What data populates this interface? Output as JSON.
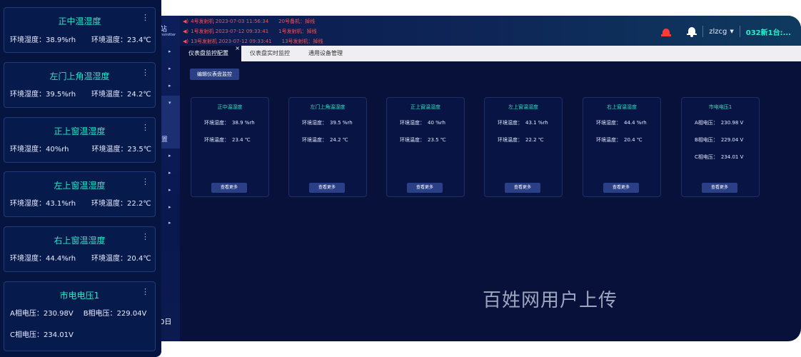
{
  "alarms": [
    {
      "text": "4号发射机 2023-07-03 11:56:34",
      "extra": "20号备机：掉线"
    },
    {
      "text": "1号发射机 2023-07-12 09:33:41",
      "extra": "1号发射机：掉线"
    },
    {
      "text": "13号发射机 2023-07-12 09:33:41",
      "extra": "13号发射机：掉线"
    }
  ],
  "header": {
    "site_fragment": "站",
    "site_sub": "ransmitter",
    "user": "zlzcg",
    "station": "032新1台:..."
  },
  "sidebar": {
    "active_fragment": "置",
    "date_fragment": "0日"
  },
  "tabs": [
    {
      "label": "仪表盘监控配置",
      "active": true
    },
    {
      "label": "仪表盘实时监控",
      "active": false
    },
    {
      "label": "通用设备管理",
      "active": false
    }
  ],
  "edit_button": "编辑仪表盘监控",
  "more_label": "查看更多",
  "dash_cards": [
    {
      "title": "正中温湿度",
      "rows": [
        {
          "k": "环境湿度：",
          "v": "38.9  %rh"
        },
        {
          "k": "环境温度：",
          "v": "23.4  ℃"
        }
      ]
    },
    {
      "title": "左门上角温湿度",
      "rows": [
        {
          "k": "环境湿度：",
          "v": "39.5  %rh"
        },
        {
          "k": "环境温度：",
          "v": "24.2  ℃"
        }
      ]
    },
    {
      "title": "正上窗温湿度",
      "rows": [
        {
          "k": "环境湿度：",
          "v": "40  %rh"
        },
        {
          "k": "环境温度：",
          "v": "23.5  ℃"
        }
      ]
    },
    {
      "title": "左上窗温湿度",
      "rows": [
        {
          "k": "环境湿度：",
          "v": "43.1  %rh"
        },
        {
          "k": "环境温度：",
          "v": "22.2  ℃"
        }
      ]
    },
    {
      "title": "右上窗温湿度",
      "rows": [
        {
          "k": "环境湿度：",
          "v": "44.4  %rh"
        },
        {
          "k": "环境温度：",
          "v": "20.4  ℃"
        }
      ]
    },
    {
      "title": "市电电压1",
      "rows": [
        {
          "k": "A相电压：",
          "v": "230.98  V"
        },
        {
          "k": "B相电压：",
          "v": "229.04  V"
        },
        {
          "k": "C相电压：",
          "v": "234.01  V"
        }
      ]
    }
  ],
  "widgets": [
    {
      "title": "正中温湿度",
      "a": "环境湿度：",
      "av": "38.9%rh",
      "b": "环境温度：",
      "bv": "23.4℃"
    },
    {
      "title": "左门上角温湿度",
      "a": "环境湿度：",
      "av": "39.5%rh",
      "b": "环境温度：",
      "bv": "24.2℃"
    },
    {
      "title": "正上窗温湿度",
      "a": "环境湿度：",
      "av": "40%rh",
      "b": "环境温度：",
      "bv": "23.5℃"
    },
    {
      "title": "左上窗温湿度",
      "a": "环境湿度：",
      "av": "43.1%rh",
      "b": "环境温度：",
      "bv": "22.2℃"
    },
    {
      "title": "右上窗温湿度",
      "a": "环境湿度：",
      "av": "44.4%rh",
      "b": "环境温度：",
      "bv": "20.4℃"
    }
  ],
  "power_widget": {
    "title": "市电电压1",
    "a": "A相电压：",
    "av": "230.98V",
    "b": "B相电压：",
    "bv": "229.04V",
    "c": "C相电压：",
    "cv": "234.01V"
  },
  "watermark": "百姓网用户上传",
  "colors": {
    "accent": "#25e6c8",
    "alarm": "#ff4f4f",
    "bg": "#07113a"
  }
}
